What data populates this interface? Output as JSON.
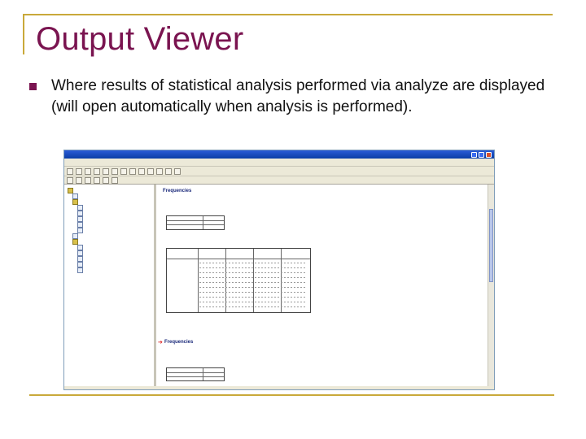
{
  "slide": {
    "title": "Output Viewer",
    "bullet_text": "Where results of statistical analysis performed via analyze are displayed (will open automatically when analysis is performed).",
    "accent_color": "#7a1450",
    "frame_color": "#c9a93a"
  },
  "viewer": {
    "outline_icons": [
      "folder-icon",
      "document-icon"
    ],
    "content": {
      "heading_1": "Frequencies",
      "heading_2": "Frequencies",
      "arrow_icon": "red-arrow-icon"
    }
  }
}
